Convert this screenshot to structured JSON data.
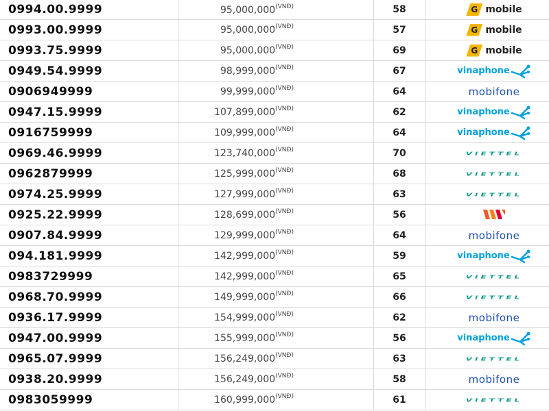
{
  "currency_label": "(VNĐ)",
  "rows": [
    {
      "number": "0994.00.9999",
      "price": "95,000,000",
      "score": "58",
      "network": "Gmobile",
      "logo_text": "mobile"
    },
    {
      "number": "0993.00.9999",
      "price": "95,000,000",
      "score": "57",
      "network": "Gmobile",
      "logo_text": "mobile"
    },
    {
      "number": "0993.75.9999",
      "price": "95,000,000",
      "score": "69",
      "network": "Gmobile",
      "logo_text": "mobile"
    },
    {
      "number": "0949.54.9999",
      "price": "98,999,000",
      "score": "67",
      "network": "Vinaphone",
      "logo_text": "vinaphone"
    },
    {
      "number": "0906949999",
      "price": "99,999,000",
      "score": "64",
      "network": "Mobifone",
      "logo_text": "mobifone"
    },
    {
      "number": "0947.15.9999",
      "price": "107,899,000",
      "score": "62",
      "network": "Vinaphone",
      "logo_text": "vinaphone"
    },
    {
      "number": "0916759999",
      "price": "109,999,000",
      "score": "64",
      "network": "Vinaphone",
      "logo_text": "vinaphone"
    },
    {
      "number": "0969.46.9999",
      "price": "123,740,000",
      "score": "70",
      "network": "Viettel",
      "logo_text": "VIETTEL"
    },
    {
      "number": "0962879999",
      "price": "125,999,000",
      "score": "68",
      "network": "Viettel",
      "logo_text": "VIETTEL"
    },
    {
      "number": "0974.25.9999",
      "price": "127,999,000",
      "score": "63",
      "network": "Viettel",
      "logo_text": "VIETTEL"
    },
    {
      "number": "0925.22.9999",
      "price": "128,699,000",
      "score": "56",
      "network": "Vietnamobile",
      "logo_text": ""
    },
    {
      "number": "0907.84.9999",
      "price": "129,999,000",
      "score": "64",
      "network": "Mobifone",
      "logo_text": "mobifone"
    },
    {
      "number": "094.181.9999",
      "price": "142,999,000",
      "score": "59",
      "network": "Vinaphone",
      "logo_text": "vinaphone"
    },
    {
      "number": "0983729999",
      "price": "142,999,000",
      "score": "65",
      "network": "Viettel",
      "logo_text": "VIETTEL"
    },
    {
      "number": "0968.70.9999",
      "price": "149,999,000",
      "score": "66",
      "network": "Viettel",
      "logo_text": "VIETTEL"
    },
    {
      "number": "0936.17.9999",
      "price": "154,999,000",
      "score": "62",
      "network": "Mobifone",
      "logo_text": "mobifone"
    },
    {
      "number": "0947.00.9999",
      "price": "155,999,000",
      "score": "56",
      "network": "Vinaphone",
      "logo_text": "vinaphone"
    },
    {
      "number": "0965.07.9999",
      "price": "156,249,000",
      "score": "63",
      "network": "Viettel",
      "logo_text": "VIETTEL"
    },
    {
      "number": "0938.20.9999",
      "price": "156,249,000",
      "score": "58",
      "network": "Mobifone",
      "logo_text": "mobifone"
    },
    {
      "number": "0983059999",
      "price": "160,999,000",
      "score": "61",
      "network": "Viettel",
      "logo_text": "VIETTEL"
    }
  ],
  "colors": {
    "gmobile": "#f5b400",
    "vinaphone": "#00a0df",
    "mobifone": "#1f4fb4",
    "viettel": "#139a8c",
    "vietnamobile": "#f15a24"
  }
}
